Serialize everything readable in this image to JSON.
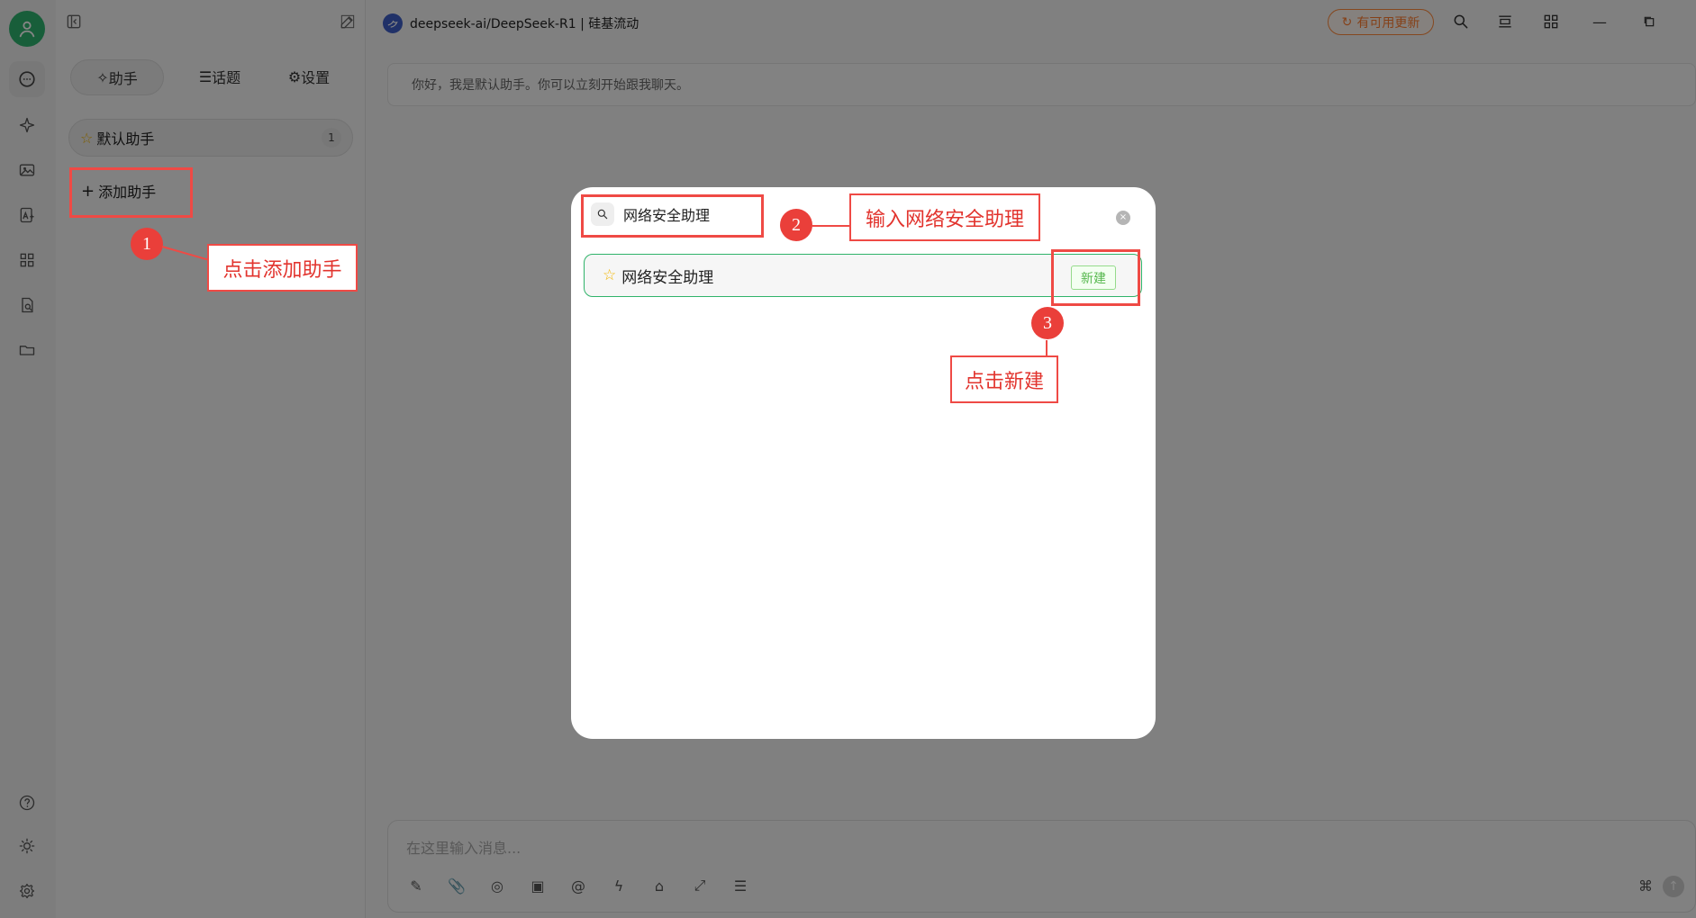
{
  "header": {
    "model_name": "deepseek-ai/DeepSeek-R1 | 硅基流动",
    "update_label": "有可用更新"
  },
  "sidebar": {
    "tabs": [
      {
        "label": "助手"
      },
      {
        "label": "话题"
      },
      {
        "label": "设置"
      }
    ],
    "assistant": {
      "name": "默认助手",
      "count": "1"
    },
    "add_assistant": "添加助手"
  },
  "chat": {
    "greeting": "你好，我是默认助手。你可以立刻开始跟我聊天。",
    "input_placeholder": "在这里输入消息..."
  },
  "modal": {
    "search_value": "网络安全助理",
    "result_name": "网络安全助理",
    "new_label": "新建"
  },
  "annotations": {
    "step_1_number": "1",
    "step_1_text": "点击添加助手",
    "step_2_number": "2",
    "step_2_text": "输入网络安全助理",
    "step_3_number": "3",
    "step_3_text": "点击新建"
  },
  "colors": {
    "primary_green": "#2fb46f",
    "annotation_red": "#ef4a45",
    "update_orange": "#ff7d2f"
  }
}
